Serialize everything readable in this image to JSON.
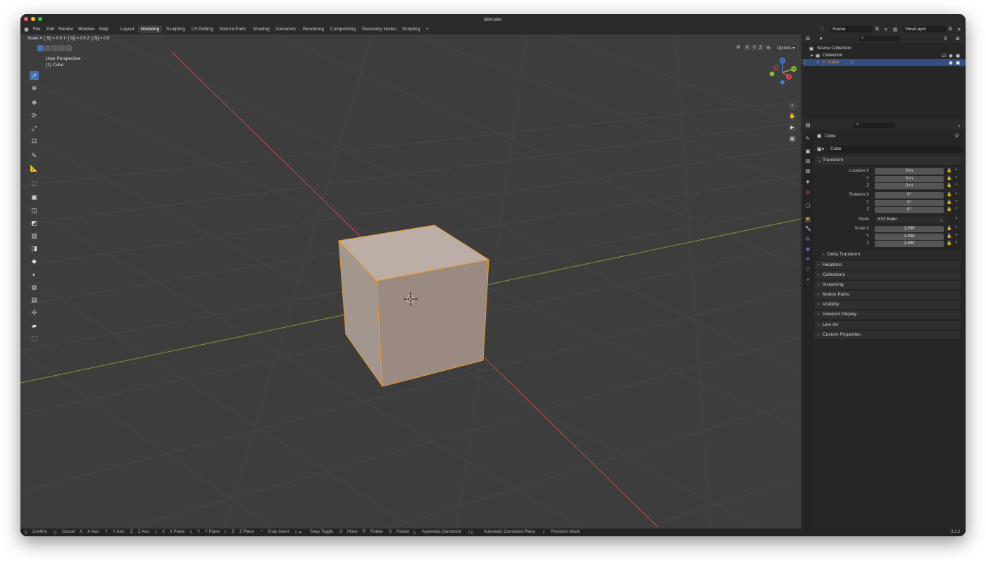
{
  "window": {
    "title": "Blender"
  },
  "menu": [
    "File",
    "Edit",
    "Render",
    "Window",
    "Help"
  ],
  "workspaces": [
    "Layout",
    "Modeling",
    "Sculpting",
    "UV Editing",
    "Texture Paint",
    "Shading",
    "Animation",
    "Rendering",
    "Compositing",
    "Geometry Nodes",
    "Scripting",
    "+"
  ],
  "active_workspace": "Modeling",
  "scene": {
    "name": "Scene",
    "view_layer": "ViewLayer"
  },
  "viewport": {
    "header_info": "Scale X: [.5|] = 0.5   Y: [.5|] = 0.5   Z: [.5|] = 0.5",
    "overlay_title": "User Perspective",
    "overlay_object": "(1) Cube",
    "options_label": "Options",
    "xyz": [
      "X",
      "Y",
      "Z"
    ],
    "gizmo": {
      "x": "X",
      "y": "Y",
      "z": "Z"
    }
  },
  "colors": {
    "accent": "#4772b3",
    "selection": "#e89b2a",
    "x_axis": "#d94a5a",
    "y_axis": "#8ab33a",
    "z_axis": "#3f7fd9",
    "cube_face": "#b3a49b"
  },
  "outliner": {
    "rows": [
      {
        "label": "Scene Collection",
        "icon": "scene-collection-icon"
      },
      {
        "label": "Collection",
        "icon": "collection-icon"
      },
      {
        "label": "Cube",
        "icon": "mesh-icon"
      }
    ]
  },
  "properties": {
    "object_name": "Cube",
    "datablock_name": "Cube",
    "transform_title": "Transform",
    "location": {
      "label": "Location X",
      "y_label": "Y",
      "z_label": "Z",
      "x": "0 m",
      "y": "0 m",
      "z": "0 m"
    },
    "rotation": {
      "label": "Rotation X",
      "y_label": "Y",
      "z_label": "Z",
      "x": "0°",
      "y": "0°",
      "z": "0°"
    },
    "mode": {
      "label": "Mode",
      "value": "XYZ Euler"
    },
    "scale": {
      "label": "Scale X",
      "y_label": "Y",
      "z_label": "Z",
      "x": "1.000",
      "y": "1.000",
      "z": "1.000"
    },
    "delta_transform": "Delta Transform",
    "panels": [
      "Relations",
      "Collections",
      "Instancing",
      "Motion Paths",
      "Visibility",
      "Viewport Display",
      "Line Art",
      "Custom Properties"
    ]
  },
  "status": {
    "items": [
      "Confirm",
      "Cancel",
      "X",
      "X Axis",
      "Y",
      "Y Axis",
      "Z",
      "Z Axis",
      "X",
      "X Plane",
      "Y",
      "Y Plane",
      "Z",
      "Z Plane",
      "Snap Invert",
      "Snap Toggle",
      "G",
      "Move",
      "R",
      "Rotate",
      "S",
      "Resize",
      "Automatic Constraint",
      "Automatic Constraint Plane",
      "Precision Mode"
    ],
    "version": "3.2.2"
  }
}
